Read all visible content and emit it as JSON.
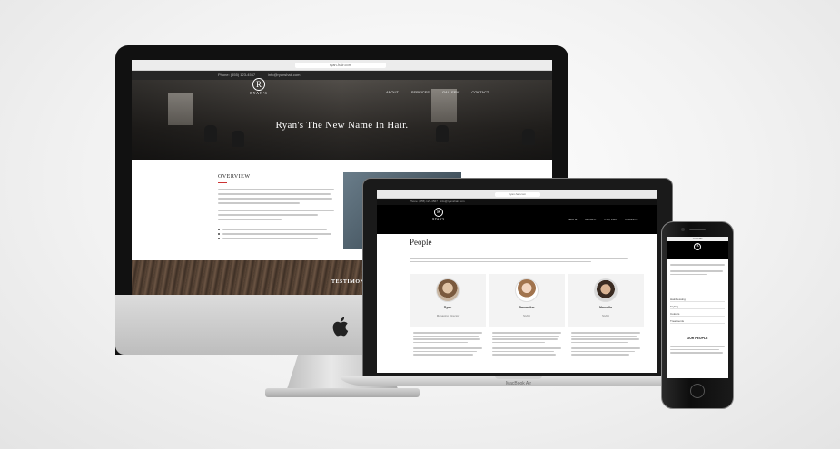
{
  "imac": {
    "url": "ryan-hair.com",
    "topbar_phone": "Phone: (555) 123-4567",
    "topbar_email": "info@ryanshair.com",
    "logo_letter": "R",
    "logo_text": "RYAN'S",
    "nav": [
      "ABOUT",
      "SERVICES",
      "GALLERY",
      "CONTACT"
    ],
    "hero_title": "Ryan's The New Name In Hair.",
    "overview_heading": "OVERVIEW",
    "testimonials_label": "TESTIMONIALS"
  },
  "macbook": {
    "url": "ryan-hair.com",
    "topbar_phone": "Phone: (555) 123-4567",
    "topbar_email": "info@ryanshair.com",
    "logo_letter": "R",
    "logo_text": "RYAN'S",
    "nav": [
      "ABOUT",
      "PEOPLE",
      "GALLERY",
      "CONTACT"
    ],
    "people_title": "People",
    "people": [
      {
        "name": "Ryan",
        "role": "Managing Director"
      },
      {
        "name": "Samantha",
        "role": "Stylist"
      },
      {
        "name": "Marcello",
        "role": "Stylist"
      }
    ],
    "base_label": "MacBook Air"
  },
  "iphone": {
    "status": "12:00 PM",
    "logo_letter": "R",
    "menu": [
      "Hairdressing",
      "Styling",
      "Colours",
      "Treatments"
    ],
    "section_label": "OUR PEOPLE"
  },
  "colors": {
    "accent": "#c33333",
    "dark": "#111111"
  }
}
